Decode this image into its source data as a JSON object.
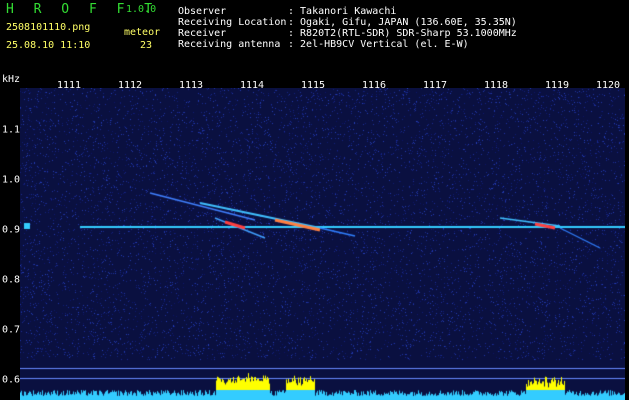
{
  "header": {
    "app_name": "H R O F F T",
    "version": "1.0.0",
    "filename": "2508101110.png",
    "meteor_label": "meteor",
    "meteor_count": "23",
    "datetime": "25.08.10 11:10",
    "observer_label": "Observer",
    "observer_value": ": Takanori Kawachi",
    "location_label": "Receiving Location",
    "location_value": ": Ogaki, Gifu, JAPAN (136.60E, 35.35N)",
    "receiver_label": "Receiver",
    "receiver_value": ": R820T2(RTL-SDR) SDR-Sharp 53.1000MHz",
    "antenna_label": "Receiving antenna",
    "antenna_value": ": 2el-HB9CV Vertical (el. E-W)"
  },
  "axes": {
    "x_ticks": [
      "1111",
      "1112",
      "1113",
      "1114",
      "1115",
      "1116",
      "1117",
      "1118",
      "1119",
      "1120"
    ],
    "y_unit": "kHz",
    "y_ticks": [
      "1.1",
      "1.0",
      "0.9",
      "0.8",
      "0.7",
      "0.6"
    ]
  },
  "colors": {
    "background": "#0a1040",
    "carrier": "#33ccff",
    "meteor_head": "#ff4040",
    "power_trace": "#33ccff",
    "power_peak": "#ffff00",
    "header_yellow": "#ffff66",
    "header_green": "#33dd33"
  }
}
